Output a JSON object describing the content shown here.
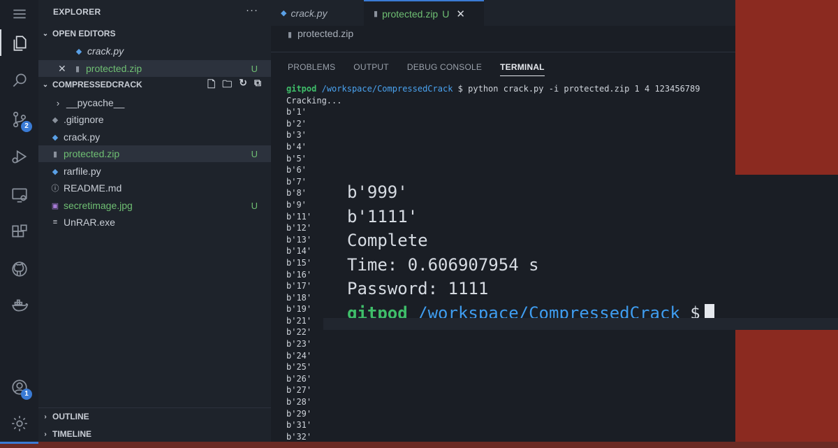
{
  "sidebar": {
    "title": "EXPLORER",
    "more": "···",
    "open_editors_label": "OPEN EDITORS",
    "open_editors": [
      {
        "name": "crack.py",
        "status": ""
      },
      {
        "name": "protected.zip",
        "status": "U"
      }
    ],
    "folder_label": "COMPRESSEDCRACK",
    "files": [
      {
        "name": "__pycache__",
        "status": ""
      },
      {
        "name": ".gitignore",
        "status": ""
      },
      {
        "name": "crack.py",
        "status": ""
      },
      {
        "name": "protected.zip",
        "status": "U"
      },
      {
        "name": "rarfile.py",
        "status": ""
      },
      {
        "name": "README.md",
        "status": ""
      },
      {
        "name": "secretimage.jpg",
        "status": "U"
      },
      {
        "name": "UnRAR.exe",
        "status": ""
      }
    ],
    "outline_label": "OUTLINE",
    "timeline_label": "TIMELINE"
  },
  "activity": {
    "scm_badge": "2",
    "account_badge": "1"
  },
  "editor": {
    "tabs": [
      {
        "label": "crack.py"
      },
      {
        "label": "protected.zip",
        "status": "U",
        "close": "✕"
      }
    ],
    "breadcrumb": "protected.zip"
  },
  "panel": {
    "tabs": [
      "PROBLEMS",
      "OUTPUT",
      "DEBUG CONSOLE",
      "TERMINAL"
    ],
    "prompt_user": "gitpod",
    "prompt_path": "/workspace/CompressedCrack",
    "prompt_sign": "$",
    "command": "python crack.py -i protected.zip 1 4 123456789",
    "output_lines": [
      "Cracking...",
      "b'1'",
      "b'2'",
      "b'3'",
      "b'4'",
      "b'5'",
      "b'6'",
      "b'7'",
      "b'8'",
      "b'9'",
      "b'11'",
      "b'12'",
      "b'13'",
      "b'14'",
      "b'15'",
      "b'16'",
      "b'17'",
      "b'18'",
      "b'19'",
      "b'21'",
      "b'22'",
      "b'23'",
      "b'24'",
      "b'25'",
      "b'26'",
      "b'27'",
      "b'28'",
      "b'29'",
      "b'31'",
      "b'32'"
    ]
  },
  "zoom": {
    "lines": [
      "b'999'",
      "b'1111'",
      "Complete",
      "Time: 0.606907954 s",
      "Password: 1111"
    ],
    "prompt_user": "gitpod",
    "prompt_path": "/workspace/CompressedCrack",
    "prompt_sign": "$"
  }
}
